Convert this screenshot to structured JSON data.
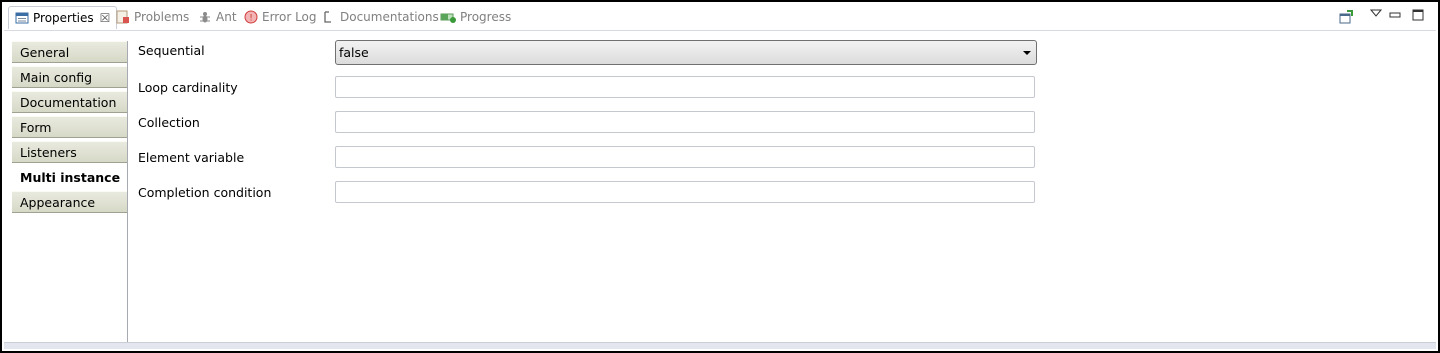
{
  "tabs": [
    {
      "label": "Properties",
      "active": true,
      "icon": "properties-icon"
    },
    {
      "label": "Problems",
      "active": false,
      "icon": "problems-icon"
    },
    {
      "label": "Ant",
      "active": false,
      "icon": "ant-icon"
    },
    {
      "label": "Error Log",
      "active": false,
      "icon": "error-log-icon"
    },
    {
      "label": "Documentations",
      "active": false,
      "icon": "documentations-icon"
    },
    {
      "label": "Progress",
      "active": false,
      "icon": "progress-icon"
    }
  ],
  "sidebar": {
    "items": [
      {
        "label": "General"
      },
      {
        "label": "Main config"
      },
      {
        "label": "Documentation"
      },
      {
        "label": "Form"
      },
      {
        "label": "Listeners"
      },
      {
        "label": "Multi instance",
        "selected": true
      },
      {
        "label": "Appearance"
      }
    ]
  },
  "form": {
    "sequential": {
      "label": "Sequential",
      "value": "false"
    },
    "loop_cardinality": {
      "label": "Loop cardinality",
      "value": ""
    },
    "collection": {
      "label": "Collection",
      "value": ""
    },
    "element_variable": {
      "label": "Element variable",
      "value": ""
    },
    "completion_condition": {
      "label": "Completion condition",
      "value": ""
    }
  },
  "colors": {
    "tab_sidebar": "#d7d9c7",
    "accent_green": "#3a9a3a",
    "error_red": "#d23b3b"
  }
}
